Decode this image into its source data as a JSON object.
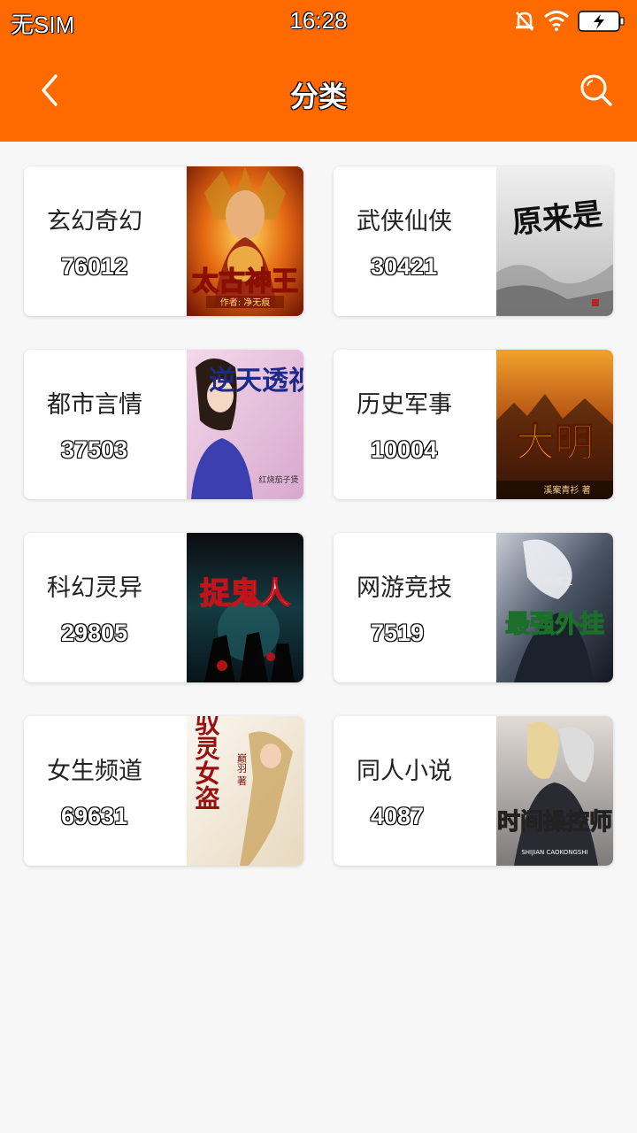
{
  "status": {
    "carrier": "无SIM",
    "time": "16:28",
    "icons": [
      "mute-bell-icon",
      "wifi-icon",
      "battery-charging-icon"
    ]
  },
  "nav": {
    "title": "分类",
    "back_icon": "chevron-left-icon",
    "search_icon": "search-icon"
  },
  "colors": {
    "header": "#ff6a00",
    "background": "#f7f7f7",
    "card": "#ffffff"
  },
  "categories": [
    {
      "name": "玄幻奇幻",
      "count": "76012",
      "cover_text": "太古神王",
      "cover_author": "作者: 净无痕"
    },
    {
      "name": "武侠仙侠",
      "count": "30421",
      "cover_text": "原来是",
      "cover_author": ""
    },
    {
      "name": "都市言情",
      "count": "37503",
      "cover_text": "逆天透视眼",
      "cover_author": "红烧茄子煲"
    },
    {
      "name": "历史军事",
      "count": "10004",
      "cover_text": "大明",
      "cover_author": "溪案青衫 著"
    },
    {
      "name": "科幻灵异",
      "count": "29805",
      "cover_text": "捉鬼人",
      "cover_author": ""
    },
    {
      "name": "网游竞技",
      "count": "7519",
      "cover_text": "最强外挂",
      "cover_author": "网游之"
    },
    {
      "name": "女生频道",
      "count": "69631",
      "cover_text": "驭灵女盗",
      "cover_author": "巅羽 著"
    },
    {
      "name": "同人小说",
      "count": "4087",
      "cover_text": "时间操控师",
      "cover_author": "SHIJIAN CAOKONGSHI"
    }
  ]
}
